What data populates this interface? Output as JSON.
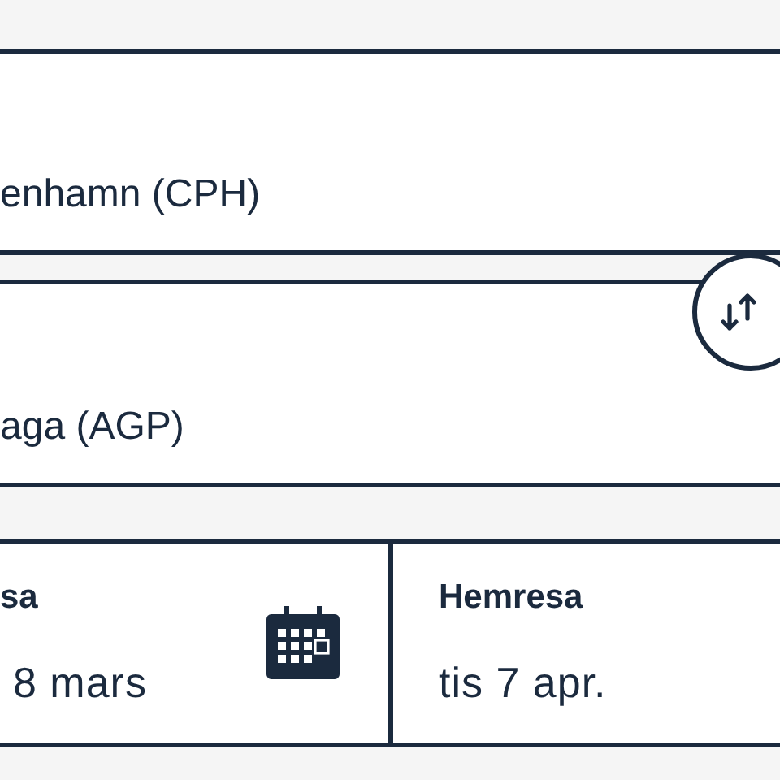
{
  "origin_field": {
    "value": "enhamn (CPH)"
  },
  "destination_field": {
    "value": "aga (AGP)"
  },
  "dates": [
    {
      "kind": "with-icon",
      "label": "sa",
      "value": "8 mars"
    },
    {
      "kind": "plain",
      "label": "Hemresa",
      "value": "tis 7 apr."
    }
  ]
}
